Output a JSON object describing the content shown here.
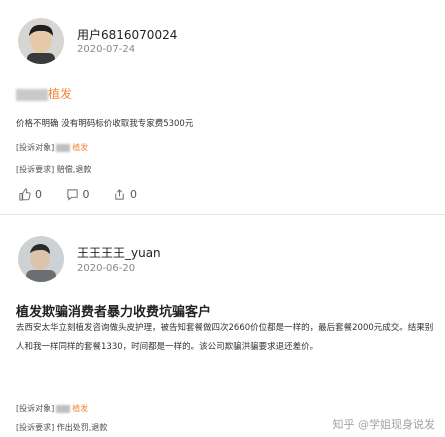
{
  "post1": {
    "username": "用户6816070024",
    "date": "2020-07-24",
    "title_tail": "植发",
    "content": "价格不明确 没有明码标价收取我专家费5300元",
    "target_label": "[投诉对象]",
    "target_tail": "植发",
    "request_label": "[投诉要求]",
    "request_value": "赔偿,退款",
    "actions": {
      "like": "0",
      "comment": "0",
      "share": "0"
    }
  },
  "post2": {
    "username": "王王王王_yuan",
    "date": "2020-06-20",
    "title": "植发欺骗消费者暴力收费坑骗客户",
    "content": "去西安太华立刻植发咨询做头皮护理，被告知套餐做四次2660价位都是一样的，最后套餐2000元成交。结果别人和我一样同样的套餐1330，时间都是一样的。该公司欺骗洪骗要求退还差价。",
    "target_label": "[投诉对象]",
    "target_tail": "植发",
    "request_label": "[投诉要求]",
    "request_value": "作出处罚,退款"
  },
  "watermark": "知乎 @学姐现身说发"
}
